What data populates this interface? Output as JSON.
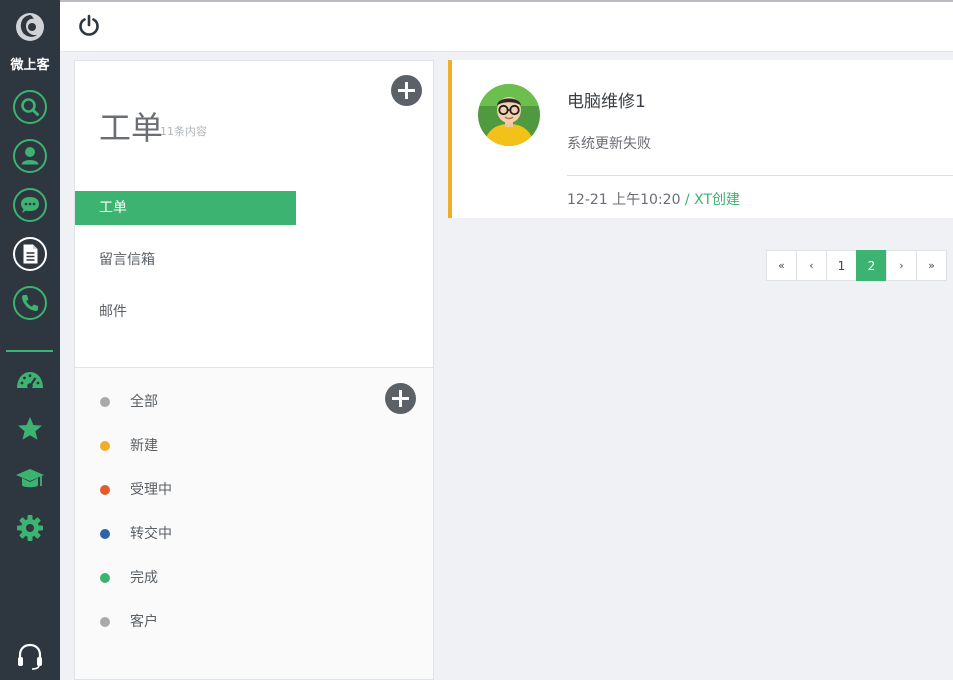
{
  "app": {
    "brand_name": "微上客"
  },
  "sidebar": {
    "icons": [
      "search-icon",
      "user-icon",
      "chat-icon",
      "document-icon",
      "phone-icon",
      "dashboard-icon",
      "star-icon",
      "graduation-cap-icon",
      "gear-icon",
      "headset-icon"
    ],
    "active_icon": "document-icon",
    "accent_color": "#3cb371"
  },
  "panel": {
    "title": "工单",
    "subtitle": "11条内容",
    "menu": [
      {
        "label": "工单",
        "active": true
      },
      {
        "label": "留言信箱",
        "active": false
      },
      {
        "label": "邮件",
        "active": false
      }
    ],
    "statuses": [
      {
        "label": "全部",
        "color": "#a9a9a9"
      },
      {
        "label": "新建",
        "color": "#f0ad28"
      },
      {
        "label": "受理中",
        "color": "#e55a2a"
      },
      {
        "label": "转交中",
        "color": "#2f63a8"
      },
      {
        "label": "完成",
        "color": "#3cb371"
      },
      {
        "label": "客户",
        "color": "#a9a9a9"
      }
    ]
  },
  "ticket": {
    "title": "电脑维修1",
    "description": "系统更新失败",
    "time": "12-21 上午10:20",
    "creator": " / XT创建",
    "status_color": "#f0ad28"
  },
  "pagination": {
    "first": "«",
    "prev": "‹",
    "pages": [
      "1",
      "2"
    ],
    "current": "2",
    "next": "›",
    "last": "»"
  }
}
